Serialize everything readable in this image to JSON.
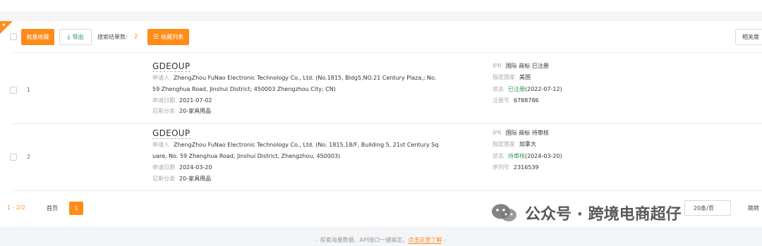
{
  "toolbar": {
    "bulk_collect_label": "批量收藏",
    "export_label": "导出",
    "result_count_label": "搜索结果数:",
    "result_count": "2",
    "collect_list_label": "收藏列表",
    "sort_label": "相关度"
  },
  "results": [
    {
      "index": "1",
      "name": "GDEOUP",
      "applicant_label": "申请人",
      "applicant_line1": "ZhengZhou FuNao Electronic Technology Co., Ltd. (No.1815, Bldg5,NO.21 Century Plaza,; No.",
      "applicant_line2": "59 Zhenghua Road, Jinshui District; 450003 Zhengzhou City; CN)",
      "date_label": "申请日期",
      "date": "2021-07-02",
      "class_label": "尼斯分类",
      "class": "20-家具用品",
      "ipr_label": "IPR",
      "ipr": "国际 商标 已注册",
      "country_label": "指定国家",
      "country": "美国",
      "status_label": "状态",
      "status": "已注册",
      "status_date": "(2022-07-12)",
      "number_label": "注册号",
      "number": "6788786"
    },
    {
      "index": "2",
      "name": "GDEOUP",
      "applicant_label": "申请人",
      "applicant_line1": "ZhengZhou FuNao Electronic Technology Co., Ltd. (No. 1815,18/F, Building 5, 21st Century Sq",
      "applicant_line2": "uare, No. 59 Zhenghua Road, Jinshui District, Zhengzhou, 450003)",
      "date_label": "申请日期",
      "date": "2024-03-20",
      "class_label": "尼斯分类",
      "class": "20-家具用品",
      "ipr_label": "IPR",
      "ipr": "国际 商标 待审核",
      "country_label": "指定国家",
      "country": "加拿大",
      "status_label": "状态",
      "status": "待审核",
      "status_date": "(2024-03-20)",
      "number_label": "序列号",
      "number": "2316539"
    }
  ],
  "pager": {
    "range": "1 - 2/2",
    "first_label": "首页",
    "current_page": "1",
    "per_page": "20条/页",
    "goto_label": "跳转"
  },
  "footer": {
    "text_before": "- 探索海量数据、API接口一键搞定，",
    "link": "点击这里了解",
    "text_after": " -"
  },
  "watermark": {
    "text": "公众号 · 跨境电商超仔"
  },
  "colors": {
    "accent": "#ff8c1a",
    "status_green": "#2f9a4e",
    "export_green": "#1a8a6e"
  }
}
